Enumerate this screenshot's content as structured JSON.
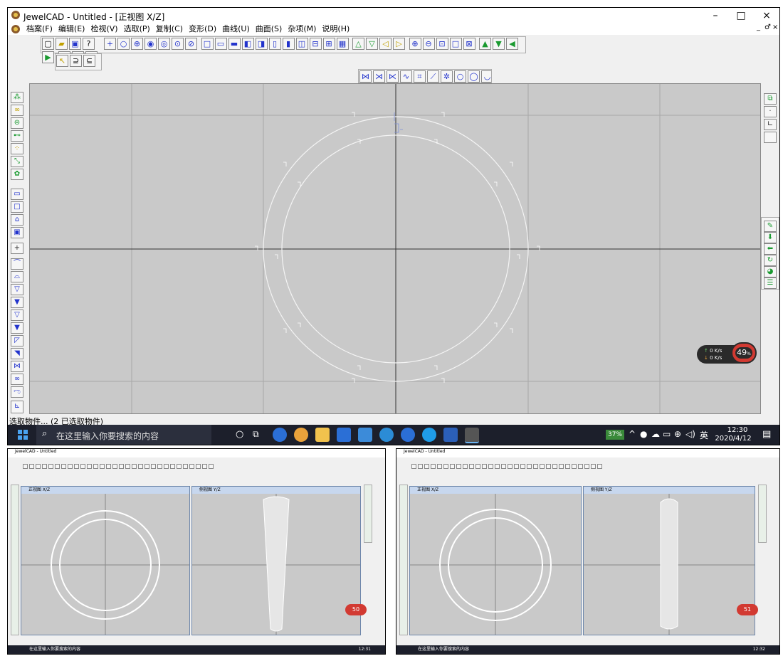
{
  "window": {
    "title": "JewelCAD - Untitled - [正视图 X/Z]",
    "controls": {
      "minimize": "–",
      "maximize": "□",
      "close": "×",
      "mdi_min": "_",
      "mdi_restore": "♂",
      "mdi_close": "×"
    }
  },
  "menu": [
    "档案(F)",
    "编辑(E)",
    "检视(V)",
    "选取(P)",
    "复制(C)",
    "变形(D)",
    "曲线(U)",
    "曲面(S)",
    "杂项(M)",
    "说明(H)"
  ],
  "toolbar2": [
    "↖",
    "⊇",
    "⊆"
  ],
  "status_text": "选取物件... (2 已选取物件)",
  "taskbar": {
    "search_placeholder": "在这里输入你要搜索的内容",
    "battery": "37%",
    "ime": "英",
    "time": "12:30",
    "date": "2020/4/12"
  },
  "overlay": {
    "upload": "0 K/s",
    "download": "0 K/s",
    "percent": "49",
    "unit": "%"
  },
  "thumb_left": {
    "title": "JewelCAD - Untitled",
    "sub1": "正视图 X/Z",
    "sub2": "侧视图 Y/Z",
    "badge": "50",
    "search": "在这里输入你要搜索的内容",
    "time": "12:31"
  },
  "thumb_right": {
    "title": "JewelCAD - Untitled",
    "sub1": "正视图 X/Z",
    "sub2": "侧视图 Y/Z",
    "badge": "51",
    "search": "在这里输入你要搜索的内容",
    "time": "12:32"
  },
  "colors": {
    "viewport_bg": "#c9c9c9",
    "taskbar": "#1c1f2b",
    "accent_blue": "#2233cc",
    "badge_red": "#d23a32"
  }
}
